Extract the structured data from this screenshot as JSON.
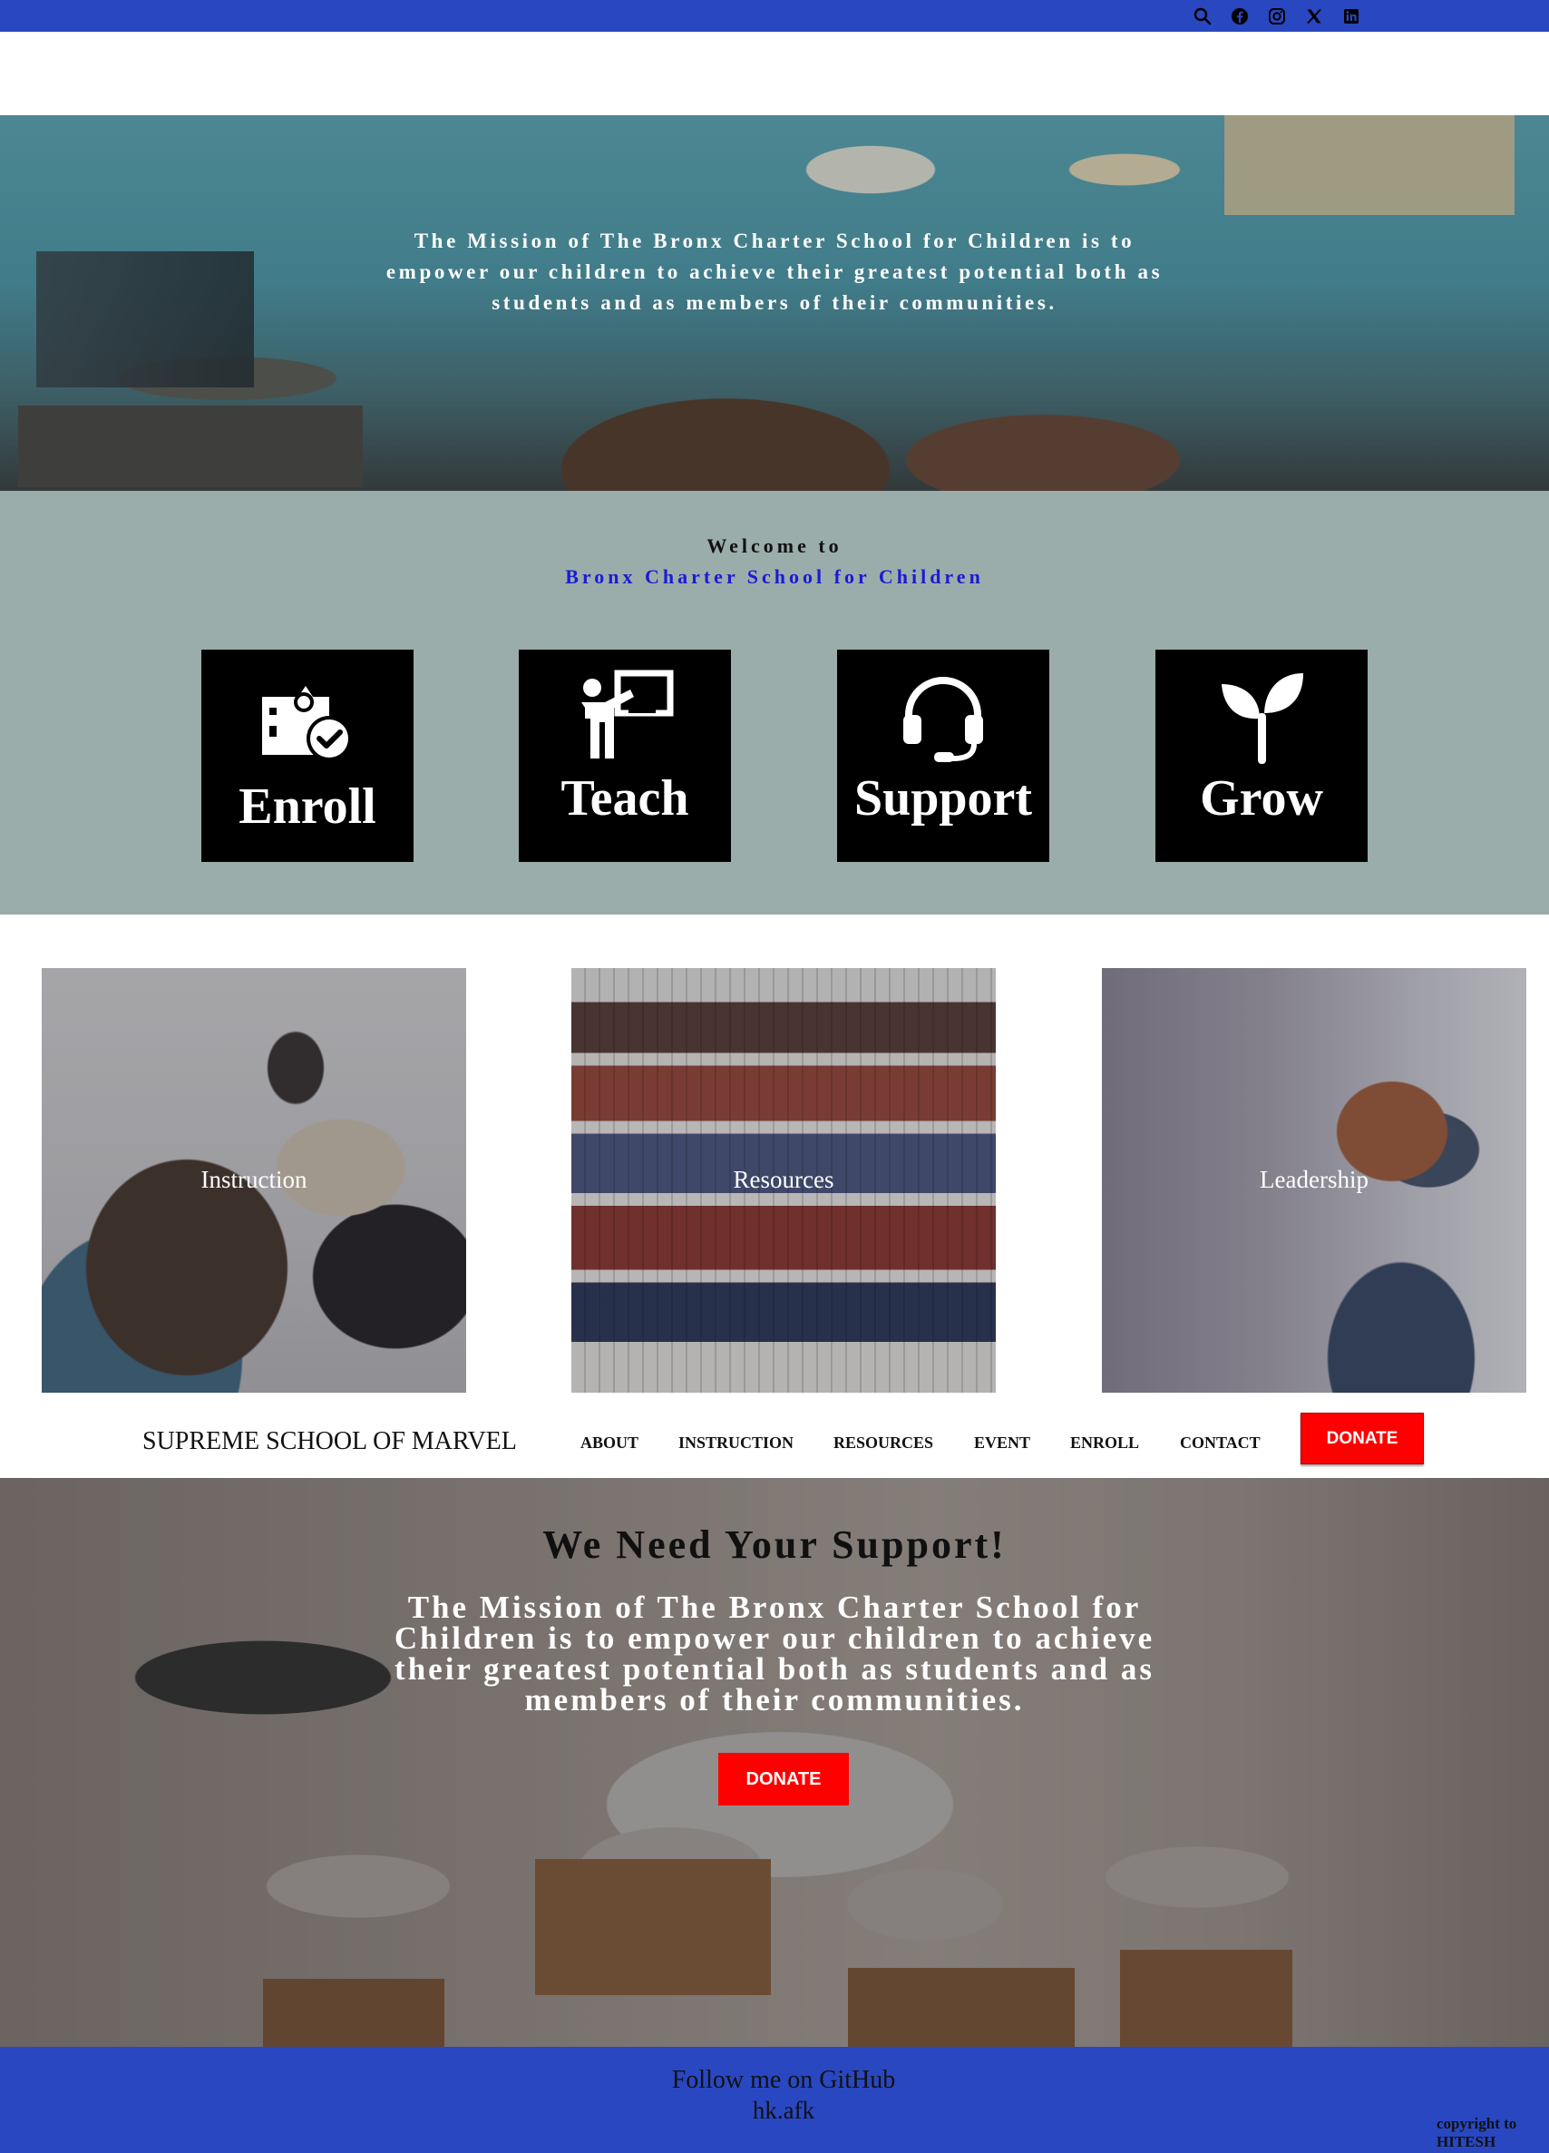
{
  "header": {
    "icons": [
      "search-icon",
      "facebook-icon",
      "instagram-icon",
      "x-icon",
      "linkedin-icon"
    ],
    "bar_color": "#2947c1"
  },
  "hero": {
    "mission": "The Mission of The Bronx Charter School for Children is to empower our children to achieve their greatest potential both as students and as members of their communities."
  },
  "welcome": {
    "line1": "Welcome to",
    "line2": "Bronx Charter School for Children",
    "tiles": [
      {
        "label": "Enroll",
        "icon": "school-check-icon"
      },
      {
        "label": "Teach",
        "icon": "teacher-icon"
      },
      {
        "label": "Support",
        "icon": "headset-icon"
      },
      {
        "label": "Grow",
        "icon": "sprout-icon"
      }
    ]
  },
  "cards": [
    {
      "caption": "Instruction"
    },
    {
      "caption": "Resources"
    },
    {
      "caption": "Leadership"
    }
  ],
  "nav": {
    "brand": "SUPREME SCHOOL OF MARVEL",
    "items": [
      "ABOUT",
      "INSTRUCTION",
      "RESOURCES",
      "EVENT",
      "ENROLL",
      "CONTACT"
    ],
    "donate": "DONATE"
  },
  "support": {
    "heading": "We Need Your Support!",
    "text": "The Mission of The Bronx Charter School for Children is to empower our children to achieve their greatest potential both as students and as members of their communities.",
    "donate": "DONATE"
  },
  "footer": {
    "line1": "Follow me on GitHub",
    "line2": "hk.afk",
    "copyright": "copyright to HITESH"
  },
  "colors": {
    "accent_blue": "#2947c1",
    "donate_red": "#ff0000",
    "welcome_bg": "#9badaa",
    "welcome_link": "#1b1bd6"
  }
}
